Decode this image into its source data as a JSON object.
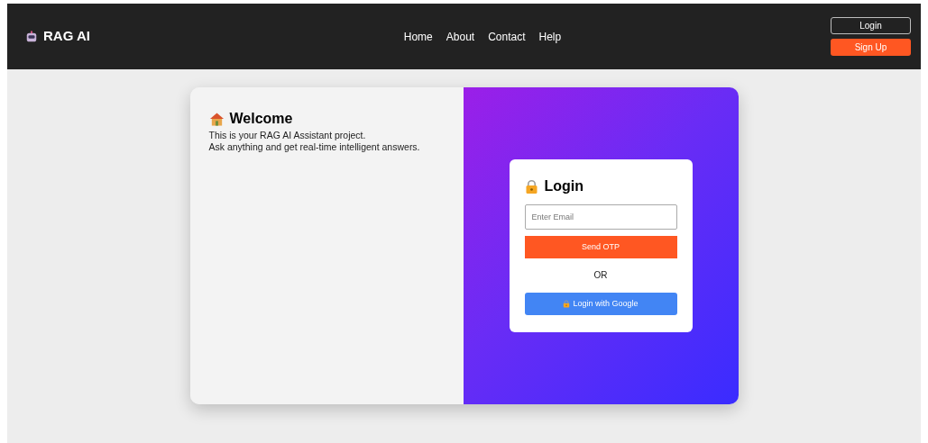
{
  "brand": {
    "name": "RAG AI"
  },
  "nav": [
    "Home",
    "About",
    "Contact",
    "Help"
  ],
  "header_buttons": [
    {
      "label": "Login",
      "kind": "outline"
    },
    {
      "label": "Sign Up",
      "kind": "primary"
    }
  ],
  "welcome": {
    "title": "Welcome",
    "lines": [
      "This is your RAG AI Assistant project.",
      "Ask anything and get real-time intelligent answers."
    ]
  },
  "login": {
    "title": "Login",
    "email": {
      "placeholder": "Enter Email"
    },
    "send_button": "Send OTP",
    "divider": "OR",
    "google_button": "Login with Google"
  }
}
